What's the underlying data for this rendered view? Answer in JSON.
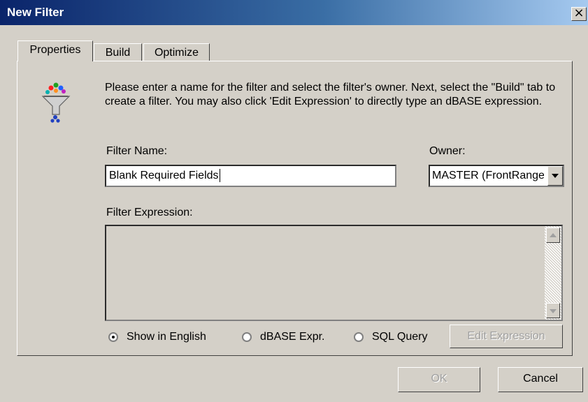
{
  "window": {
    "title": "New Filter",
    "close_label": "×"
  },
  "tabs": [
    {
      "label": "Properties",
      "active": true
    },
    {
      "label": "Build",
      "active": false
    },
    {
      "label": "Optimize",
      "active": false
    }
  ],
  "instructions": "Please enter a name for the filter and select the filter's owner.  Next, select the \"Build\" tab to create a filter.  You may also click 'Edit Expression' to directly type an dBASE expression.",
  "filter_name": {
    "label": "Filter Name:",
    "value": "Blank Required Fields"
  },
  "owner": {
    "label": "Owner:",
    "value": "MASTER (FrontRange)"
  },
  "filter_expression": {
    "label": "Filter Expression:",
    "value": ""
  },
  "mode_options": [
    {
      "label": "Show in English",
      "selected": true
    },
    {
      "label": "dBASE Expr.",
      "selected": false
    },
    {
      "label": "SQL Query",
      "selected": false
    }
  ],
  "buttons": {
    "edit_expression": "Edit Expression",
    "ok": "OK",
    "cancel": "Cancel"
  },
  "icons": {
    "wizard": "funnel-filter-icon"
  }
}
